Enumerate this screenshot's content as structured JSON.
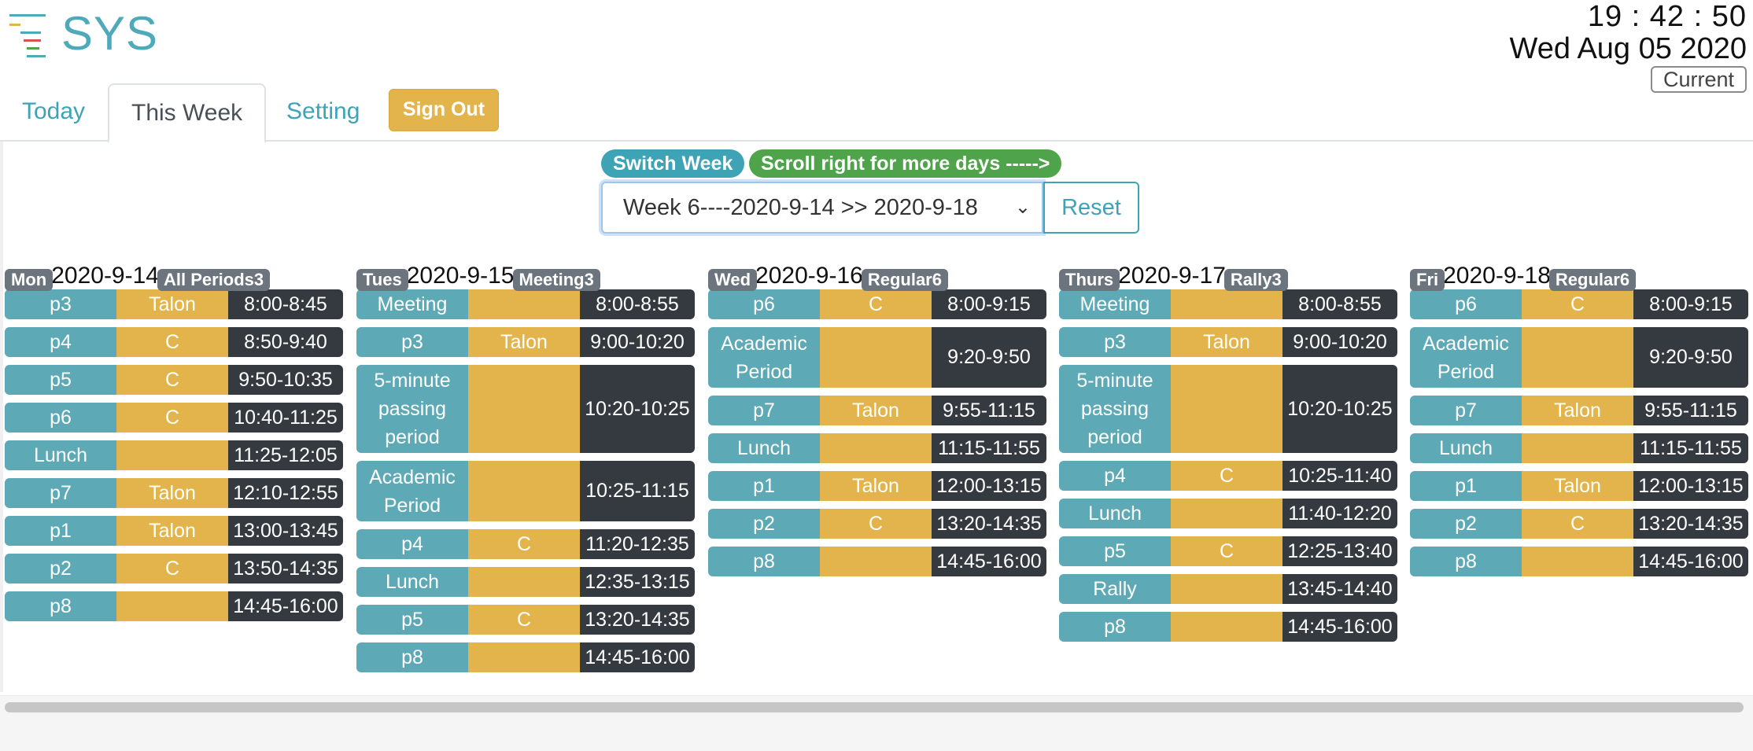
{
  "app": {
    "title": "SYS"
  },
  "clock": {
    "time": "19 : 42 : 50",
    "date": "Wed Aug 05 2020",
    "current_label": "Current"
  },
  "tabs": [
    {
      "label": "Today",
      "active": false
    },
    {
      "label": "This Week",
      "active": true
    },
    {
      "label": "Setting",
      "active": false
    }
  ],
  "signout_label": "Sign Out",
  "week_controls": {
    "switch_label": "Switch Week",
    "scroll_hint": "Scroll right for more days ----->",
    "selected_week": "Week 6----2020-9-14 >> 2020-9-18",
    "reset_label": "Reset"
  },
  "colors": {
    "period": "#5da9b5",
    "class": "#e4b44c",
    "time": "#343a40",
    "accent": "#3ea3b5",
    "hint": "#4fa34a"
  },
  "days": [
    {
      "name": "Mon",
      "date": "2020-9-14",
      "schedule": "All Periods3",
      "periods": [
        {
          "period": "p3",
          "class": "Talon",
          "time": "8:00-8:45"
        },
        {
          "period": "p4",
          "class": "C",
          "time": "8:50-9:40"
        },
        {
          "period": "p5",
          "class": "C",
          "time": "9:50-10:35"
        },
        {
          "period": "p6",
          "class": "C",
          "time": "10:40-11:25"
        },
        {
          "period": "Lunch",
          "class": "",
          "time": "11:25-12:05"
        },
        {
          "period": "p7",
          "class": "Talon",
          "time": "12:10-12:55"
        },
        {
          "period": "p1",
          "class": "Talon",
          "time": "13:00-13:45"
        },
        {
          "period": "p2",
          "class": "C",
          "time": "13:50-14:35"
        },
        {
          "period": "p8",
          "class": "",
          "time": "14:45-16:00"
        }
      ]
    },
    {
      "name": "Tues",
      "date": "2020-9-15",
      "schedule": "Meeting3",
      "periods": [
        {
          "period": "Meeting",
          "class": "",
          "time": "8:00-8:55"
        },
        {
          "period": "p3",
          "class": "Talon",
          "time": "9:00-10:20"
        },
        {
          "period": "5-minute passing period",
          "class": "",
          "time": "10:20-10:25"
        },
        {
          "period": "Academic Period",
          "class": "",
          "time": "10:25-11:15"
        },
        {
          "period": "p4",
          "class": "C",
          "time": "11:20-12:35"
        },
        {
          "period": "Lunch",
          "class": "",
          "time": "12:35-13:15"
        },
        {
          "period": "p5",
          "class": "C",
          "time": "13:20-14:35"
        },
        {
          "period": "p8",
          "class": "",
          "time": "14:45-16:00"
        }
      ]
    },
    {
      "name": "Wed",
      "date": "2020-9-16",
      "schedule": "Regular6",
      "periods": [
        {
          "period": "p6",
          "class": "C",
          "time": "8:00-9:15"
        },
        {
          "period": "Academic Period",
          "class": "",
          "time": "9:20-9:50"
        },
        {
          "period": "p7",
          "class": "Talon",
          "time": "9:55-11:15"
        },
        {
          "period": "Lunch",
          "class": "",
          "time": "11:15-11:55"
        },
        {
          "period": "p1",
          "class": "Talon",
          "time": "12:00-13:15"
        },
        {
          "period": "p2",
          "class": "C",
          "time": "13:20-14:35"
        },
        {
          "period": "p8",
          "class": "",
          "time": "14:45-16:00"
        }
      ]
    },
    {
      "name": "Thurs",
      "date": "2020-9-17",
      "schedule": "Rally3",
      "periods": [
        {
          "period": "Meeting",
          "class": "",
          "time": "8:00-8:55"
        },
        {
          "period": "p3",
          "class": "Talon",
          "time": "9:00-10:20"
        },
        {
          "period": "5-minute passing period",
          "class": "",
          "time": "10:20-10:25"
        },
        {
          "period": "p4",
          "class": "C",
          "time": "10:25-11:40"
        },
        {
          "period": "Lunch",
          "class": "",
          "time": "11:40-12:20"
        },
        {
          "period": "p5",
          "class": "C",
          "time": "12:25-13:40"
        },
        {
          "period": "Rally",
          "class": "",
          "time": "13:45-14:40"
        },
        {
          "period": "p8",
          "class": "",
          "time": "14:45-16:00"
        }
      ]
    },
    {
      "name": "Fri",
      "date": "2020-9-18",
      "schedule": "Regular6",
      "periods": [
        {
          "period": "p6",
          "class": "C",
          "time": "8:00-9:15"
        },
        {
          "period": "Academic Period",
          "class": "",
          "time": "9:20-9:50"
        },
        {
          "period": "p7",
          "class": "Talon",
          "time": "9:55-11:15"
        },
        {
          "period": "Lunch",
          "class": "",
          "time": "11:15-11:55"
        },
        {
          "period": "p1",
          "class": "Talon",
          "time": "12:00-13:15"
        },
        {
          "period": "p2",
          "class": "C",
          "time": "13:20-14:35"
        },
        {
          "period": "p8",
          "class": "",
          "time": "14:45-16:00"
        }
      ]
    }
  ]
}
